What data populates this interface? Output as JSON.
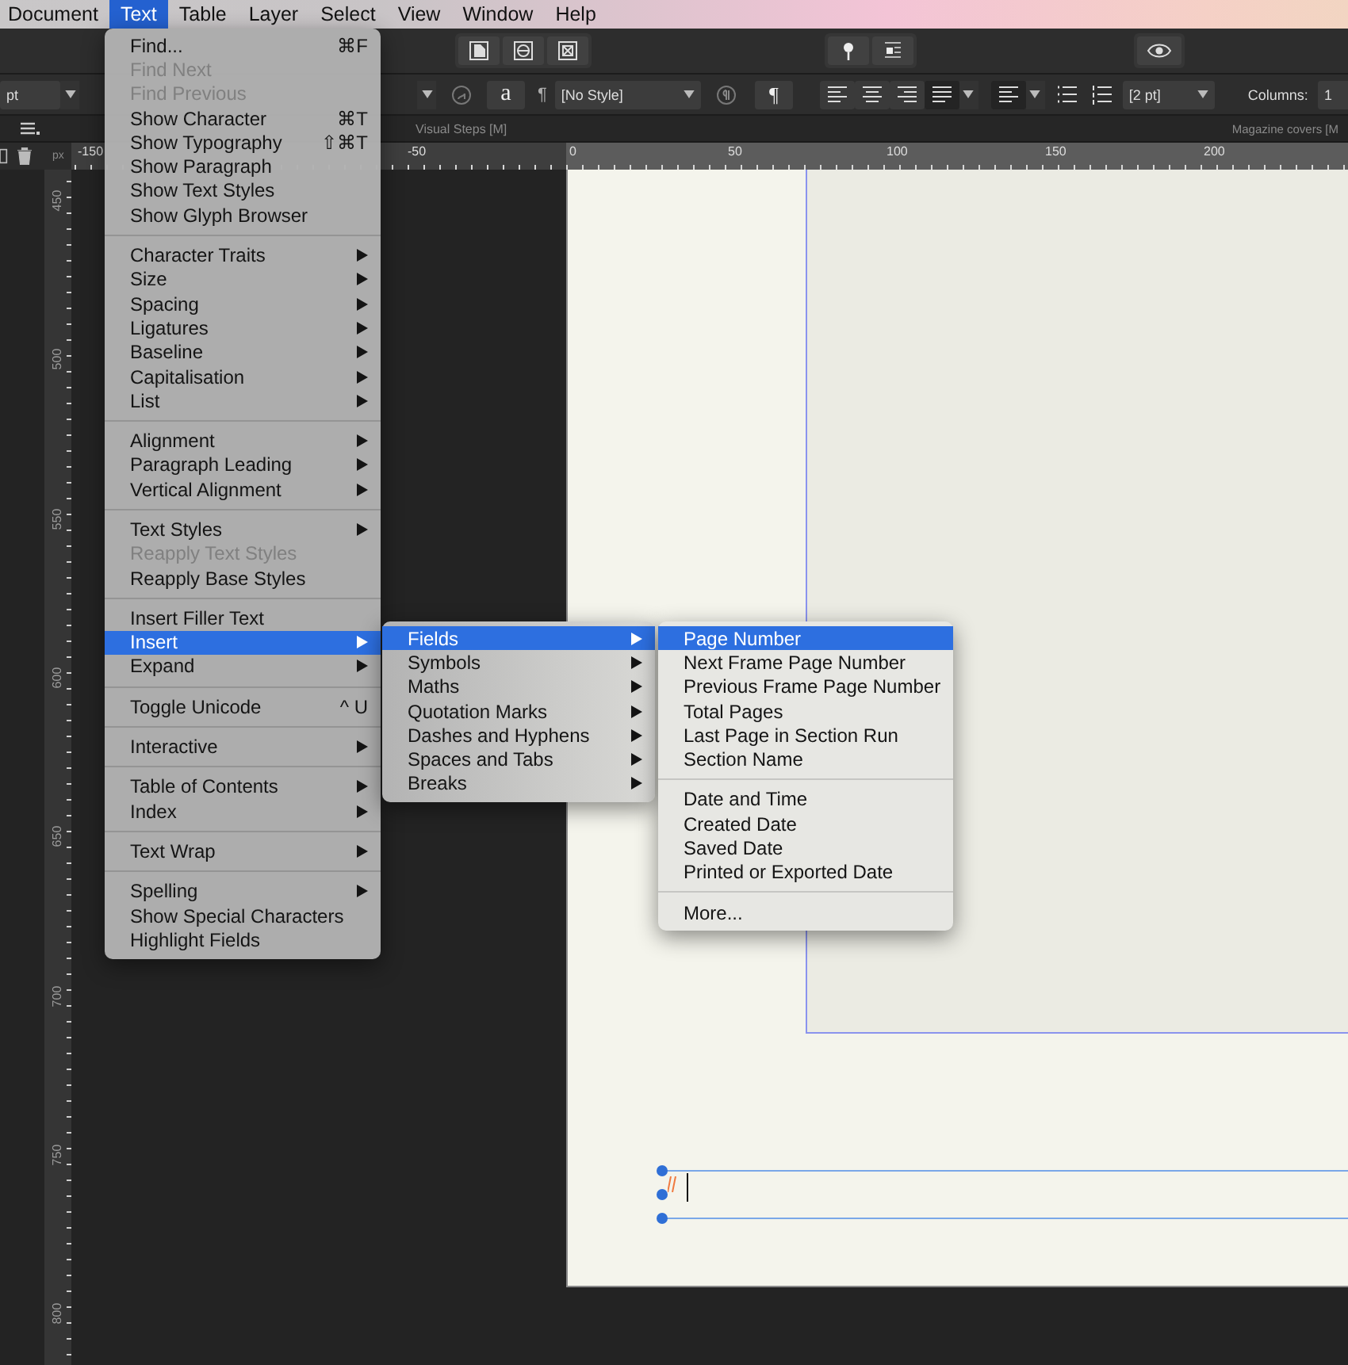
{
  "menu_bar": [
    {
      "label": "Document",
      "selected": false
    },
    {
      "label": "Text",
      "selected": true
    },
    {
      "label": "Table",
      "selected": false
    },
    {
      "label": "Layer",
      "selected": false
    },
    {
      "label": "Select",
      "selected": false
    },
    {
      "label": "View",
      "selected": false
    },
    {
      "label": "Window",
      "selected": false
    },
    {
      "label": "Help",
      "selected": false
    }
  ],
  "toolbar": {
    "size_field": "pt",
    "char_style_button": "a",
    "pilcrow_label": "¶",
    "paragraph_style_field": "[No Style]",
    "pilcrow_button": "¶",
    "spacing_field": "[2 pt]",
    "columns_label": "Columns:",
    "columns_field": "1"
  },
  "tabs": [
    {
      "label": "Visual Steps [M]"
    },
    {
      "label": "Magazine covers [M"
    }
  ],
  "ruler": {
    "unit": "px",
    "horizontal_labels": [
      "-150",
      "-50",
      "0",
      "50",
      "100",
      "150",
      "200"
    ],
    "vertical_labels": [
      "450",
      "500",
      "550",
      "600",
      "650",
      "700",
      "750",
      "800"
    ]
  },
  "text_menu": {
    "groups": [
      {
        "items": [
          {
            "label": "Find...",
            "shortcut": "⌘F",
            "submenu": false,
            "disabled": false,
            "selected": false
          },
          {
            "label": "Find Next",
            "submenu": false,
            "disabled": true,
            "selected": false
          },
          {
            "label": "Find Previous",
            "submenu": false,
            "disabled": true,
            "selected": false
          },
          {
            "label": "Show Character",
            "shortcut": "⌘T",
            "submenu": false,
            "disabled": false,
            "selected": false
          },
          {
            "label": "Show Typography",
            "shortcut": "⇧⌘T",
            "submenu": false,
            "disabled": false,
            "selected": false
          },
          {
            "label": "Show Paragraph",
            "submenu": false,
            "disabled": false,
            "selected": false
          },
          {
            "label": "Show Text Styles",
            "submenu": false,
            "disabled": false,
            "selected": false
          },
          {
            "label": "Show Glyph Browser",
            "submenu": false,
            "disabled": false,
            "selected": false
          }
        ]
      },
      {
        "items": [
          {
            "label": "Character Traits",
            "submenu": true,
            "disabled": false,
            "selected": false
          },
          {
            "label": "Size",
            "submenu": true,
            "disabled": false,
            "selected": false
          },
          {
            "label": "Spacing",
            "submenu": true,
            "disabled": false,
            "selected": false
          },
          {
            "label": "Ligatures",
            "submenu": true,
            "disabled": false,
            "selected": false
          },
          {
            "label": "Baseline",
            "submenu": true,
            "disabled": false,
            "selected": false
          },
          {
            "label": "Capitalisation",
            "submenu": true,
            "disabled": false,
            "selected": false
          },
          {
            "label": "List",
            "submenu": true,
            "disabled": false,
            "selected": false
          }
        ]
      },
      {
        "items": [
          {
            "label": "Alignment",
            "submenu": true,
            "disabled": false,
            "selected": false
          },
          {
            "label": "Paragraph Leading",
            "submenu": true,
            "disabled": false,
            "selected": false
          },
          {
            "label": "Vertical Alignment",
            "submenu": true,
            "disabled": false,
            "selected": false
          }
        ]
      },
      {
        "items": [
          {
            "label": "Text Styles",
            "submenu": true,
            "disabled": false,
            "selected": false
          },
          {
            "label": "Reapply Text Styles",
            "submenu": false,
            "disabled": true,
            "selected": false
          },
          {
            "label": "Reapply Base Styles",
            "submenu": false,
            "disabled": false,
            "selected": false
          }
        ]
      },
      {
        "items": [
          {
            "label": "Insert Filler Text",
            "submenu": false,
            "disabled": false,
            "selected": false
          },
          {
            "label": "Insert",
            "submenu": true,
            "disabled": false,
            "selected": true
          },
          {
            "label": "Expand",
            "submenu": true,
            "disabled": false,
            "selected": false
          }
        ]
      },
      {
        "items": [
          {
            "label": "Toggle Unicode",
            "shortcut": "^ U",
            "submenu": false,
            "disabled": false,
            "selected": false
          }
        ]
      },
      {
        "items": [
          {
            "label": "Interactive",
            "submenu": true,
            "disabled": false,
            "selected": false
          }
        ]
      },
      {
        "items": [
          {
            "label": "Table of Contents",
            "submenu": true,
            "disabled": false,
            "selected": false
          },
          {
            "label": "Index",
            "submenu": true,
            "disabled": false,
            "selected": false
          }
        ]
      },
      {
        "items": [
          {
            "label": "Text Wrap",
            "submenu": true,
            "disabled": false,
            "selected": false
          }
        ]
      },
      {
        "items": [
          {
            "label": "Spelling",
            "submenu": true,
            "disabled": false,
            "selected": false
          },
          {
            "label": "Show Special Characters",
            "submenu": false,
            "disabled": false,
            "selected": false
          },
          {
            "label": "Highlight Fields",
            "submenu": false,
            "disabled": false,
            "selected": false
          }
        ]
      }
    ]
  },
  "insert_submenu": {
    "groups": [
      {
        "items": [
          {
            "label": "Fields",
            "submenu": true,
            "disabled": false,
            "selected": true
          },
          {
            "label": "Symbols",
            "submenu": true,
            "disabled": false,
            "selected": false
          },
          {
            "label": "Maths",
            "submenu": true,
            "disabled": false,
            "selected": false
          },
          {
            "label": "Quotation Marks",
            "submenu": true,
            "disabled": false,
            "selected": false
          },
          {
            "label": "Dashes and Hyphens",
            "submenu": true,
            "disabled": false,
            "selected": false
          },
          {
            "label": "Spaces and Tabs",
            "submenu": true,
            "disabled": false,
            "selected": false
          },
          {
            "label": "Breaks",
            "submenu": true,
            "disabled": false,
            "selected": false
          }
        ]
      }
    ]
  },
  "fields_submenu": {
    "groups": [
      {
        "items": [
          {
            "label": "Page Number",
            "submenu": false,
            "disabled": false,
            "selected": true
          },
          {
            "label": "Next Frame Page Number",
            "submenu": false,
            "disabled": false,
            "selected": false
          },
          {
            "label": "Previous Frame Page Number",
            "submenu": false,
            "disabled": false,
            "selected": false
          },
          {
            "label": "Total Pages",
            "submenu": false,
            "disabled": false,
            "selected": false
          },
          {
            "label": "Last Page in Section Run",
            "submenu": false,
            "disabled": false,
            "selected": false
          },
          {
            "label": "Section Name",
            "submenu": false,
            "disabled": false,
            "selected": false
          }
        ]
      },
      {
        "items": [
          {
            "label": "Date and Time",
            "submenu": false,
            "disabled": false,
            "selected": false
          },
          {
            "label": "Created Date",
            "submenu": false,
            "disabled": false,
            "selected": false
          },
          {
            "label": "Saved Date",
            "submenu": false,
            "disabled": false,
            "selected": false
          },
          {
            "label": "Printed or Exported Date",
            "submenu": false,
            "disabled": false,
            "selected": false
          }
        ]
      },
      {
        "items": [
          {
            "label": "More...",
            "submenu": false,
            "disabled": false,
            "selected": false
          }
        ]
      }
    ]
  }
}
